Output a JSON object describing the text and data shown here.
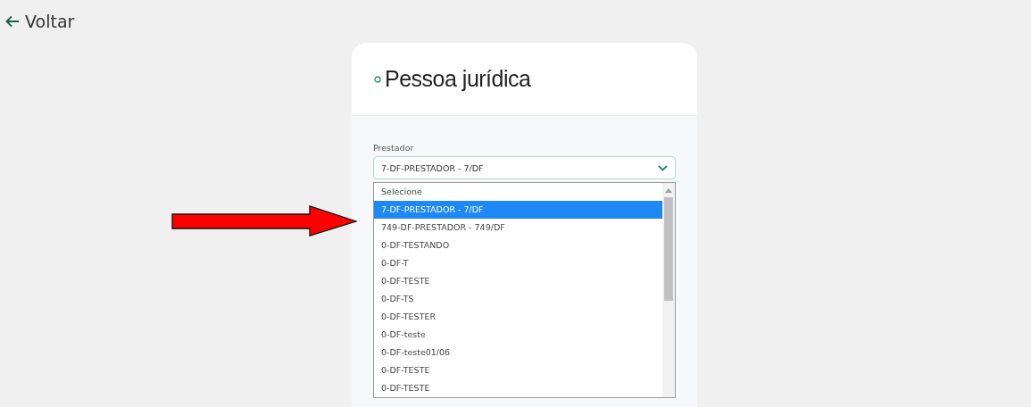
{
  "back_link": {
    "label": "Voltar"
  },
  "card": {
    "title": "Pessoa jurídica",
    "field": {
      "label": "Prestador",
      "value": "7-DF-PRESTADOR - 7/DF"
    },
    "dropdown": {
      "options": [
        {
          "label": "Selecione",
          "selected": false
        },
        {
          "label": "7-DF-PRESTADOR - 7/DF",
          "selected": true
        },
        {
          "label": "749-DF-PRESTADOR - 749/DF",
          "selected": false
        },
        {
          "label": "0-DF-TESTANDO",
          "selected": false
        },
        {
          "label": "0-DF-T",
          "selected": false
        },
        {
          "label": "0-DF-TESTE",
          "selected": false
        },
        {
          "label": "0-DF-TS",
          "selected": false
        },
        {
          "label": "0-DF-TESTER",
          "selected": false
        },
        {
          "label": "0-DF-teste",
          "selected": false
        },
        {
          "label": "0-DF-teste01/06",
          "selected": false
        },
        {
          "label": "0-DF-TESTE",
          "selected": false
        },
        {
          "label": "0-DF-TESTE",
          "selected": false
        }
      ]
    }
  }
}
